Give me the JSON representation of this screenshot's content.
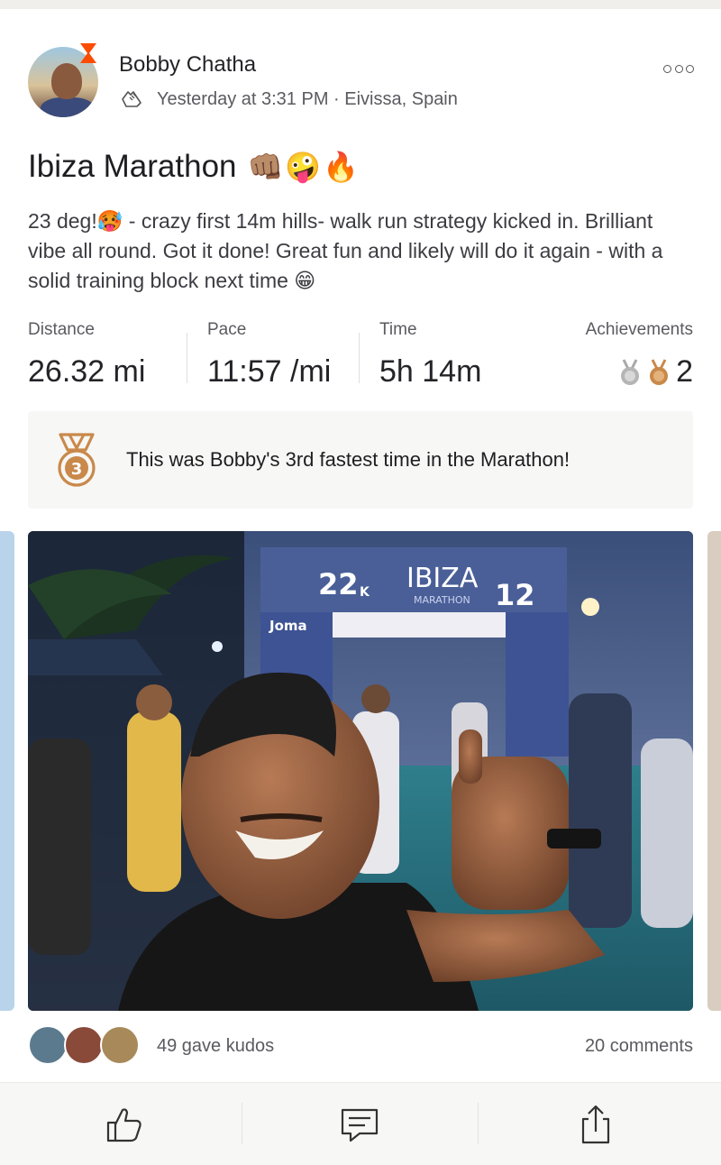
{
  "activity": {
    "athlete_name": "Bobby Chatha",
    "timestamp": "Yesterday at 3:31 PM · Eivissa, Spain",
    "title": "Ibiza Marathon",
    "title_emoji": "👊🏽🤪🔥",
    "description": "23 deg!🥵 - crazy first 14m hills- walk run strategy kicked in. Brilliant vibe all round. Got it done! Great fun and likely will do it again - with a solid training block next time 😁"
  },
  "stats": [
    {
      "label": "Distance",
      "value": "26.32 mi"
    },
    {
      "label": "Pace",
      "value": "11:57 /mi"
    },
    {
      "label": "Time",
      "value": "5h 14m"
    },
    {
      "label": "Achievements",
      "value": "2"
    }
  ],
  "achievement_banner": {
    "medal_number": "3",
    "text": "This was Bobby's 3rd fastest time in the Marathon!"
  },
  "photo": {
    "sign_line1": "22",
    "sign_line1_suffix": "K",
    "sign_brand": "IBIZA",
    "sign_sub": "MARATHON",
    "sign_line2": "12",
    "sponsor": "Joma"
  },
  "social": {
    "kudos_text": "49 gave kudos",
    "comments_text": "20 comments"
  },
  "icons": {
    "kudos": "thumbs-up-icon",
    "comment": "comment-icon",
    "share": "share-icon"
  },
  "colors": {
    "bronze": "#c8894a",
    "silver": "#a8a8a8",
    "strava_orange": "#fc4c02"
  }
}
